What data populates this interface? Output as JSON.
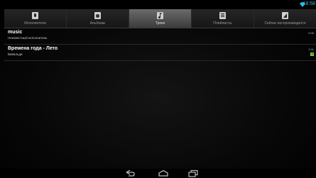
{
  "status_bar": {
    "time": "18:58",
    "wifi_icon": "wifi-icon"
  },
  "tabs": [
    {
      "label": "Исполнители",
      "icon": "microphone-icon",
      "active": false
    },
    {
      "label": "Альбомы",
      "icon": "album-icon",
      "active": false
    },
    {
      "label": "Треки",
      "icon": "music-note-icon",
      "active": true
    },
    {
      "label": "Плейлисты",
      "icon": "playlist-icon",
      "active": false
    },
    {
      "label": "Сейчас воспроизводится",
      "icon": "now-playing-icon",
      "active": false
    }
  ],
  "tracks": [
    {
      "title": "music",
      "artist": "Неизвестный исполнитель",
      "duration": "0:05",
      "playing": false
    },
    {
      "title": "Времена года - Лето",
      "artist": "Вивальди",
      "duration": "2:11",
      "playing": true
    }
  ],
  "nav_bar": {
    "back_icon": "back-icon",
    "home_icon": "home-icon",
    "recents_icon": "recent-apps-icon"
  },
  "colors": {
    "accent": "#33b5e5",
    "playing_indicator": "#7cc242",
    "active_tab": "#5a5a5a"
  }
}
